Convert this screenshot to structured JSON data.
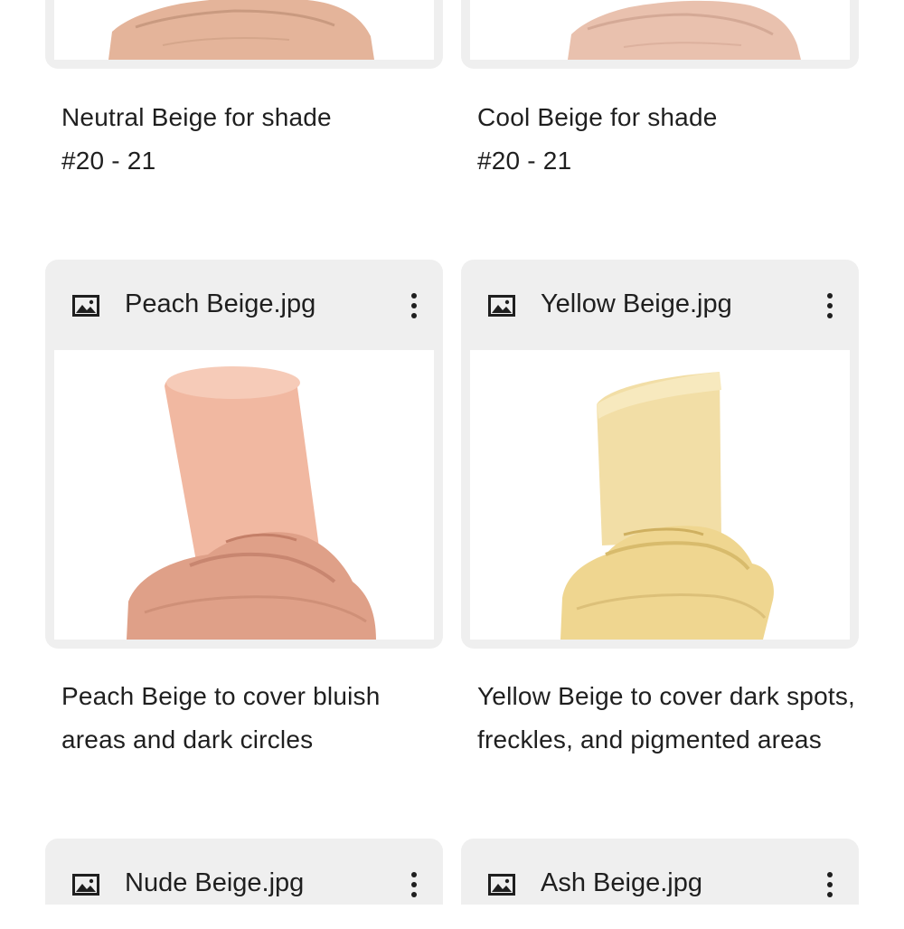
{
  "row1": {
    "captions": [
      {
        "line1": "Neutral Beige for shade",
        "line2": "#20 - 21"
      },
      {
        "line1": "Cool Beige for shade",
        "line2": "#20 - 21"
      }
    ]
  },
  "row2": {
    "cards": [
      {
        "file_name": "Peach Beige.jpg",
        "icon": "image-icon",
        "menu_icon": "more-vert-icon",
        "swatch_color": "#f2b9a3"
      },
      {
        "file_name": "Yellow Beige.jpg",
        "icon": "image-icon",
        "menu_icon": "more-vert-icon",
        "swatch_color": "#f1dda0"
      }
    ],
    "captions": [
      {
        "line1": "Peach Beige to cover bluish",
        "line2": "areas and dark circles"
      },
      {
        "line1": "Yellow Beige to cover dark spots,",
        "line2": "freckles, and pigmented areas"
      }
    ]
  },
  "row3": {
    "cards": [
      {
        "file_name": "Nude Beige.jpg",
        "icon": "image-icon",
        "menu_icon": "more-vert-icon"
      },
      {
        "file_name": "Ash Beige.jpg",
        "icon": "image-icon",
        "menu_icon": "more-vert-icon"
      }
    ]
  }
}
